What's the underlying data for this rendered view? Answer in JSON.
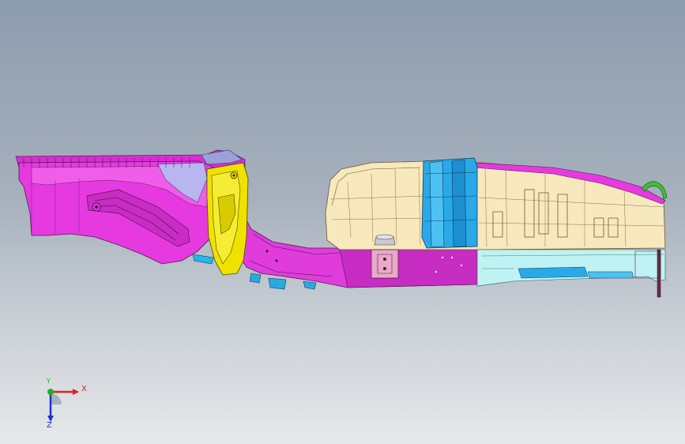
{
  "viewport": {
    "background_top": "#8d9cae",
    "background_bottom": "#e6e8ea"
  },
  "model": {
    "parts": [
      {
        "name": "rear-floor-rail",
        "color": "#e52ee0"
      },
      {
        "name": "crossmember-bracket",
        "color": "#f2e600"
      },
      {
        "name": "fuel-tank",
        "color": "#f6e6b8"
      },
      {
        "name": "tank-strap",
        "color": "#22a9e8"
      },
      {
        "name": "heat-shield",
        "color": "#bff2f2"
      },
      {
        "name": "filler-pipe",
        "color": "#39c02f"
      },
      {
        "name": "mount-bracket",
        "color": "#e7a9c8"
      }
    ]
  },
  "triad": {
    "x_label": "X",
    "y_label": "Y",
    "z_label": "Z",
    "x_color": "#e02020",
    "y_color": "#20b020",
    "z_color": "#2030d0"
  }
}
